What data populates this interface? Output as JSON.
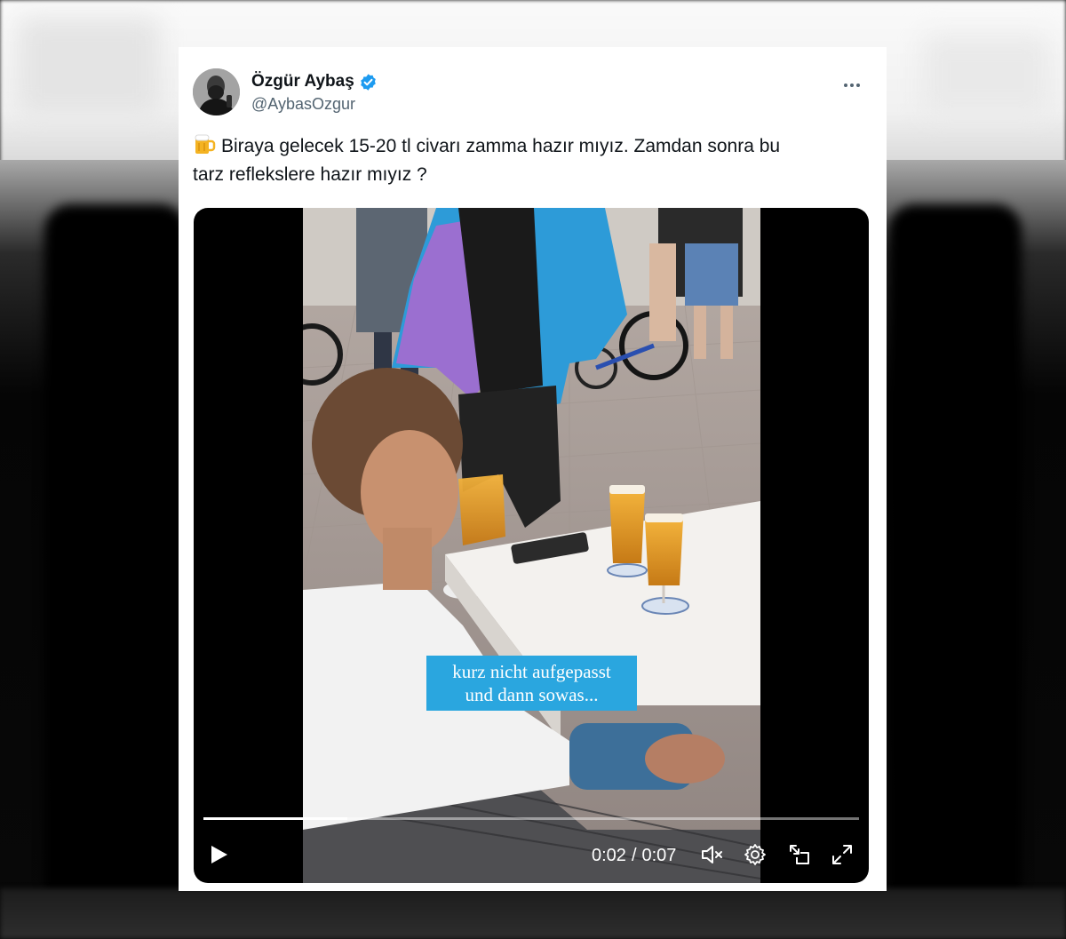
{
  "tweet": {
    "author": {
      "display_name": "Özgür Aybaş",
      "handle": "@AybasOzgur",
      "verified": true,
      "avatar_icon": "avatar-photo-icon"
    },
    "menu_icon": "more-horizontal-icon",
    "text_emoji": "beer-mug-icon",
    "text_line_1": "Biraya gelecek 15-20 tl civarı  zamma hazır mıyız. Zamdan sonra bu",
    "text_line_2": "tarz reflekslere hazır mıyız ?",
    "colors": {
      "verified_badge": "#1d9bf0",
      "name": "#0f1419",
      "handle": "#536471",
      "caption_bg": "#2aa6df"
    }
  },
  "video": {
    "caption_line_1": "kurz nicht aufgepasst",
    "caption_line_2": "und dann sowas...",
    "current_time": "0:02",
    "separator": "/",
    "duration": "0:07",
    "progress": 0.22,
    "controls": {
      "play_icon": "play-icon",
      "mute_icon": "muted-speaker-icon",
      "settings_icon": "gear-icon",
      "pip_icon": "picture-in-picture-icon",
      "fullscreen_icon": "expand-icon"
    }
  }
}
